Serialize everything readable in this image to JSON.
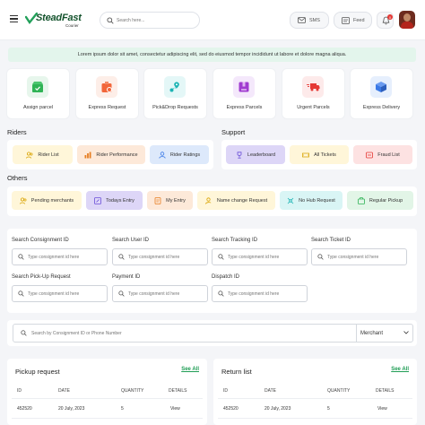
{
  "header": {
    "logo_name": "SteadFast",
    "logo_sub": "Courier",
    "search_placeholder": "Search here...",
    "sms_label": "SMS",
    "feed_label": "Feed",
    "notification_count": "0"
  },
  "banner": {
    "text": "Lorem ipsum dolor sit amet, consectetur adipiscing elit, sed do eiusmod tempor incididunt ut labore et dolore magna aliqua."
  },
  "quick_actions": [
    {
      "label": "Assign parcel",
      "icon": "parcel-check-icon",
      "bg": "#e7f6ec",
      "color": "#2fb355"
    },
    {
      "label": "Express Request",
      "icon": "express-box-icon",
      "bg": "#fdeee8",
      "color": "#f2663a"
    },
    {
      "label": "Pick&Drop Requests",
      "icon": "map-route-icon",
      "bg": "#e4f7f7",
      "color": "#1bb3b3"
    },
    {
      "label": "Express Parcels",
      "icon": "gift-box-icon",
      "bg": "#f4e8fb",
      "color": "#a03cd0"
    },
    {
      "label": "Urgent Parcels",
      "icon": "fast-truck-icon",
      "bg": "#fdeaea",
      "color": "#e53935"
    },
    {
      "label": "Express Delivery",
      "icon": "delivery-box-icon",
      "bg": "#e6effd",
      "color": "#3a79e6"
    }
  ],
  "riders": {
    "title": "Riders",
    "items": [
      {
        "label": "Rider List",
        "bg": "#fff6d9",
        "color": "#d9a300"
      },
      {
        "label": "Rider Performance",
        "bg": "#fde9d9",
        "color": "#e67e22"
      },
      {
        "label": "Rider Ratings",
        "bg": "#dde9fb",
        "color": "#3a79e6"
      }
    ]
  },
  "support": {
    "title": "Support",
    "items": [
      {
        "label": "Leaderboard",
        "bg": "#ddd6f7",
        "color": "#6b4fd8"
      },
      {
        "label": "All Tickets",
        "bg": "#fff6d9",
        "color": "#d9a300"
      },
      {
        "label": "Fraud List",
        "bg": "#fde2e2",
        "color": "#e53935"
      }
    ]
  },
  "others": {
    "title": "Others",
    "items": [
      {
        "label": "Pending merchants",
        "bg": "#fff6d9",
        "color": "#d9a300"
      },
      {
        "label": "Todays Entry",
        "bg": "#ddd6f7",
        "color": "#6b4fd8"
      },
      {
        "label": "My Entry",
        "bg": "#fde9d9",
        "color": "#e67e22"
      },
      {
        "label": "Name change Request",
        "bg": "#fff6d9",
        "color": "#d9a300"
      },
      {
        "label": "No Hub Request",
        "bg": "#d9f5f5",
        "color": "#1bb3b3"
      },
      {
        "label": "Regular Pickup",
        "bg": "#e2f5e7",
        "color": "#2fb355"
      }
    ]
  },
  "search_form": {
    "fields": [
      {
        "label": "Search Consignment ID",
        "placeholder": "Type consignment id here"
      },
      {
        "label": "Search User ID",
        "placeholder": "Type consignment id here"
      },
      {
        "label": "Search Tracking ID",
        "placeholder": "Type consignment id here"
      },
      {
        "label": "Search Ticket ID",
        "placeholder": "Type consignment id here"
      },
      {
        "label": "Search Pick-Up Request",
        "placeholder": "Type consignment id here"
      },
      {
        "label": "Payment ID",
        "placeholder": "Type consignment id here"
      },
      {
        "label": "Dispatch ID",
        "placeholder": "Type consignment id here"
      }
    ]
  },
  "global_search": {
    "placeholder": "Search by Consignment ID or Phone Number",
    "filter_value": "Merchant"
  },
  "pickup": {
    "title": "Pickup request",
    "see_all": "See All",
    "columns": [
      "ID",
      "DATE",
      "QUANTITY",
      "DETAILS"
    ],
    "row": [
      "452520",
      "20 July, 2023",
      "5",
      "View"
    ]
  },
  "returns": {
    "title": "Return list",
    "see_all": "See All",
    "columns": [
      "ID",
      "DATE",
      "QUANTITY",
      "DETAILS"
    ],
    "row": [
      "452520",
      "20 July, 2023",
      "5",
      "View"
    ]
  }
}
